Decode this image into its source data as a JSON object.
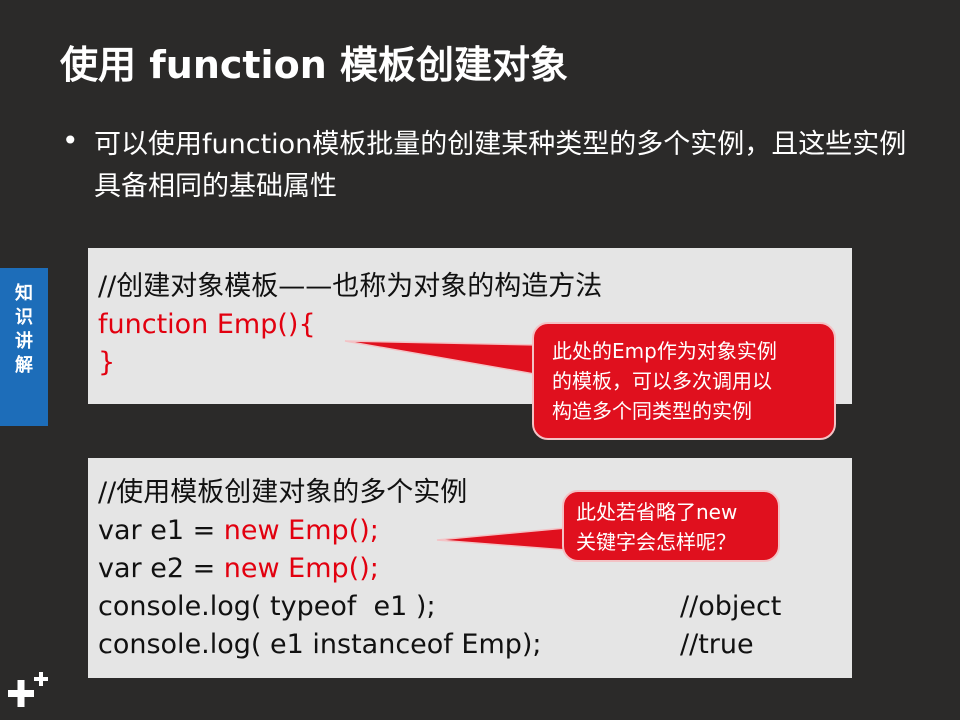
{
  "slide": {
    "title": "使用 function 模板创建对象",
    "bullet_symbol": "•",
    "bullet_text": "可以使用function模板批量的创建某种类型的多个实例，且这些实例具备相同的基础属性"
  },
  "side_tab": {
    "label": "知识讲解",
    "color": "#1d6db9"
  },
  "code_box_1": {
    "line1": "//创建对象模板——也称为对象的构造方法",
    "line2": "function Emp(){",
    "line3": "}"
  },
  "code_box_2": {
    "line1": "//使用模板创建对象的多个实例",
    "line2_prefix": "var e1 = ",
    "line2_red": "new Emp();",
    "line3_prefix": "var e2 = ",
    "line3_red": "new Emp();",
    "line4_code": "console.log( typeof  e1 );",
    "line4_comment": "//object",
    "line5_code": "console.log( e1 instanceof Emp);",
    "line5_comment": "//true"
  },
  "callout_1": {
    "line1": "此处的Emp作为对象实例",
    "line2": "的模板，可以多次调用以",
    "line3": "构造多个同类型的实例"
  },
  "callout_2": {
    "line1": "此处若省略了new",
    "line2": "关键字会怎样呢？"
  },
  "colors": {
    "background": "#2b2a29",
    "accent_red": "#e2000f",
    "code_background": "#e5e5e5"
  }
}
